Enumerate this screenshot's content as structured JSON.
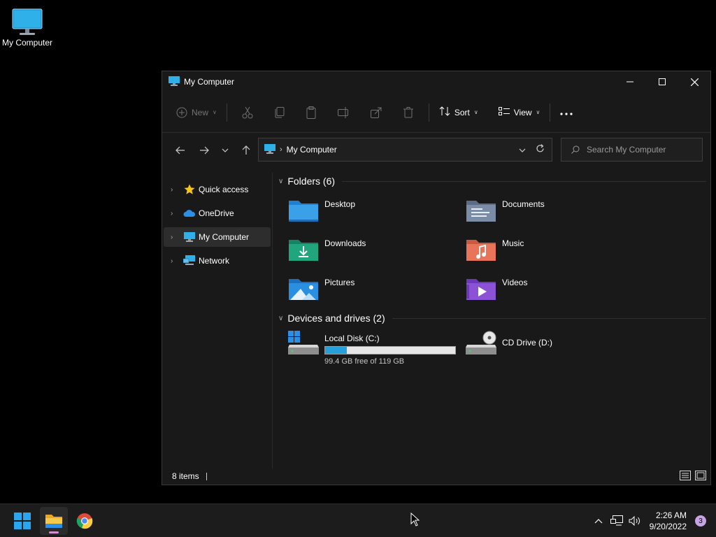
{
  "desktop": {
    "icons": [
      {
        "label": "My Computer",
        "icon": "monitor-icon"
      }
    ]
  },
  "window": {
    "title": "My Computer",
    "controls": [
      "minimize",
      "maximize",
      "close"
    ],
    "toolbar": {
      "new_label": "New",
      "sort_label": "Sort",
      "view_label": "View",
      "disabled_actions": [
        "cut-icon",
        "copy-icon",
        "paste-icon",
        "rename-icon",
        "share-icon",
        "delete-icon"
      ]
    },
    "address": {
      "crumb": "My Computer",
      "search_placeholder": "Search My Computer"
    },
    "sidebar": {
      "items": [
        {
          "label": "Quick access",
          "icon": "star-icon",
          "selected": false
        },
        {
          "label": "OneDrive",
          "icon": "cloud-icon",
          "selected": false
        },
        {
          "label": "My Computer",
          "icon": "monitor-icon",
          "selected": true
        },
        {
          "label": "Network",
          "icon": "network-icon",
          "selected": false
        }
      ]
    },
    "content": {
      "folders_header": "Folders (6)",
      "folders": [
        {
          "name": "Desktop",
          "icon": "desktop-folder-icon",
          "color": "#3aa0e8"
        },
        {
          "name": "Documents",
          "icon": "documents-folder-icon",
          "color": "#7a8ca6"
        },
        {
          "name": "Downloads",
          "icon": "downloads-folder-icon",
          "color": "#20a57c"
        },
        {
          "name": "Music",
          "icon": "music-folder-icon",
          "color": "#e8745a"
        },
        {
          "name": "Pictures",
          "icon": "pictures-folder-icon",
          "color": "#2a8fe0"
        },
        {
          "name": "Videos",
          "icon": "videos-folder-icon",
          "color": "#8b52d6"
        }
      ],
      "drives_header": "Devices and drives (2)",
      "drives": [
        {
          "name": "Local Disk (C:)",
          "icon": "hard-drive-icon",
          "free_text": "99.4 GB free of 119 GB",
          "used_fraction": 0.165
        },
        {
          "name": "CD Drive (D:)",
          "icon": "cd-drive-icon"
        }
      ]
    },
    "status": {
      "items_text": "8 items"
    }
  },
  "taskbar": {
    "apps": [
      {
        "name": "start",
        "icon": "windows-start-icon"
      },
      {
        "name": "file-explorer",
        "icon": "folder-icon",
        "active": true
      },
      {
        "name": "chrome",
        "icon": "chrome-icon"
      }
    ],
    "time": "2:26 AM",
    "date": "9/20/2022",
    "notification_count": "3"
  }
}
